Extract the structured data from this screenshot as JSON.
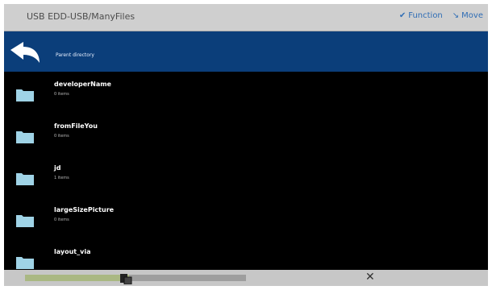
{
  "header": {
    "path": "USB EDD-USB/ManyFiles",
    "function_label": "Function",
    "move_label": "Move"
  },
  "parent": {
    "label": "Parent directory"
  },
  "files": [
    {
      "name": "developerName",
      "sub": "0 items"
    },
    {
      "name": "fromFileYou",
      "sub": "0 items"
    },
    {
      "name": "jd",
      "sub": "1 items"
    },
    {
      "name": "largeSizePicture",
      "sub": "0 items"
    },
    {
      "name": "layout_via",
      "sub": ""
    }
  ],
  "colors": {
    "titlebar": "#cfcfcf",
    "parentbar": "#0b3e7a",
    "folder": "#9fd3e6",
    "list_bg": "#000000",
    "accent": "#2f6db5"
  },
  "progress": {
    "fraction": 0.47
  },
  "icons": [
    "back-arrow-icon",
    "function-icon",
    "move-icon",
    "folder-icon",
    "paste-icon",
    "close-icon"
  ]
}
